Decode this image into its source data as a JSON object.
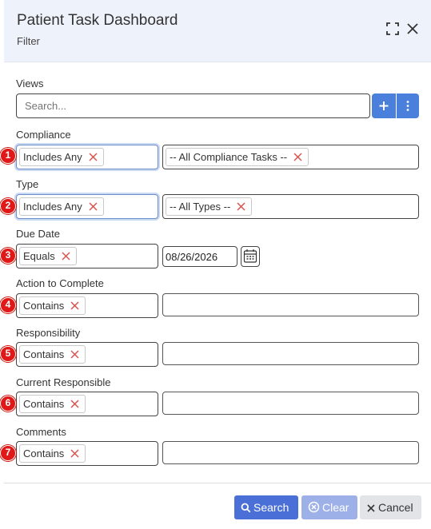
{
  "header": {
    "title": "Patient Task Dashboard",
    "subtitle": "Filter"
  },
  "views": {
    "label": "Views",
    "search_placeholder": "Search..."
  },
  "filters": [
    {
      "step": "1",
      "label": "Compliance",
      "operator": "Includes Any",
      "value_tag": "-- All Compliance Tasks --"
    },
    {
      "step": "2",
      "label": "Type",
      "operator": "Includes Any",
      "value_tag": "-- All Types --"
    },
    {
      "step": "3",
      "label": "Due Date",
      "operator": "Equals",
      "value": "08/26/2026"
    },
    {
      "step": "4",
      "label": "Action to Complete",
      "operator": "Contains",
      "value": ""
    },
    {
      "step": "5",
      "label": "Responsibility",
      "operator": "Contains",
      "value": ""
    },
    {
      "step": "6",
      "label": "Current Responsible",
      "operator": "Contains",
      "value": ""
    },
    {
      "step": "7",
      "label": "Comments",
      "operator": "Contains",
      "value": ""
    }
  ],
  "footer": {
    "search_label": "Search",
    "clear_label": "Clear",
    "cancel_label": "Cancel"
  },
  "colors": {
    "primary": "#4a6fd6",
    "disabled": "#9db1e8",
    "badge": "#e01818",
    "remove_x": "#d9534f"
  }
}
